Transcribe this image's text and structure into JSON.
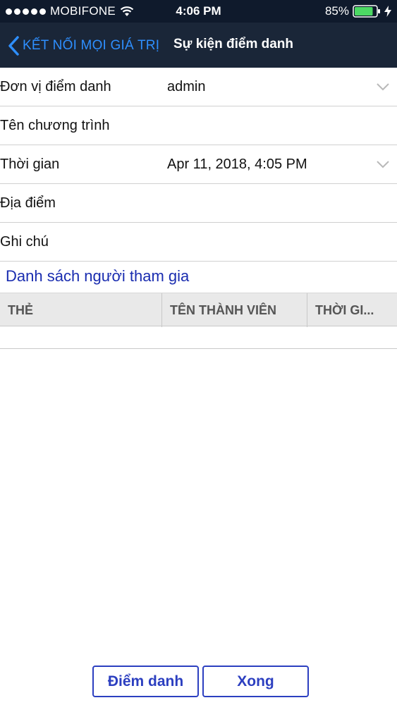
{
  "status_bar": {
    "carrier": "MOBIFONE",
    "time": "4:06 PM",
    "battery_percent": "85%",
    "battery_level": 0.85
  },
  "nav": {
    "back_label": "KẾT NỐI MỌI GIÁ TRỊ",
    "title": "Sự kiện điểm danh"
  },
  "form": {
    "rows": [
      {
        "label": "Đơn vị điểm danh",
        "value": "admin"
      },
      {
        "label": "Tên chương trình",
        "value": ""
      },
      {
        "label": "Thời gian",
        "value": "Apr 11, 2018, 4:05 PM"
      },
      {
        "label": "Địa điểm",
        "value": ""
      },
      {
        "label": "Ghi chú",
        "value": ""
      }
    ]
  },
  "participants": {
    "title": "Danh sách người tham gia",
    "columns": [
      "THẺ",
      "TÊN THÀNH VIÊN",
      "THỜI GI..."
    ],
    "rows": []
  },
  "actions": {
    "checkin_label": "Điểm danh",
    "done_label": "Xong"
  },
  "colors": {
    "nav_background": "#1a2638",
    "status_background": "#0f1a2c",
    "accent_blue": "#2e8fff",
    "button_blue": "#2c3fc0",
    "section_title": "#1a2db0"
  }
}
